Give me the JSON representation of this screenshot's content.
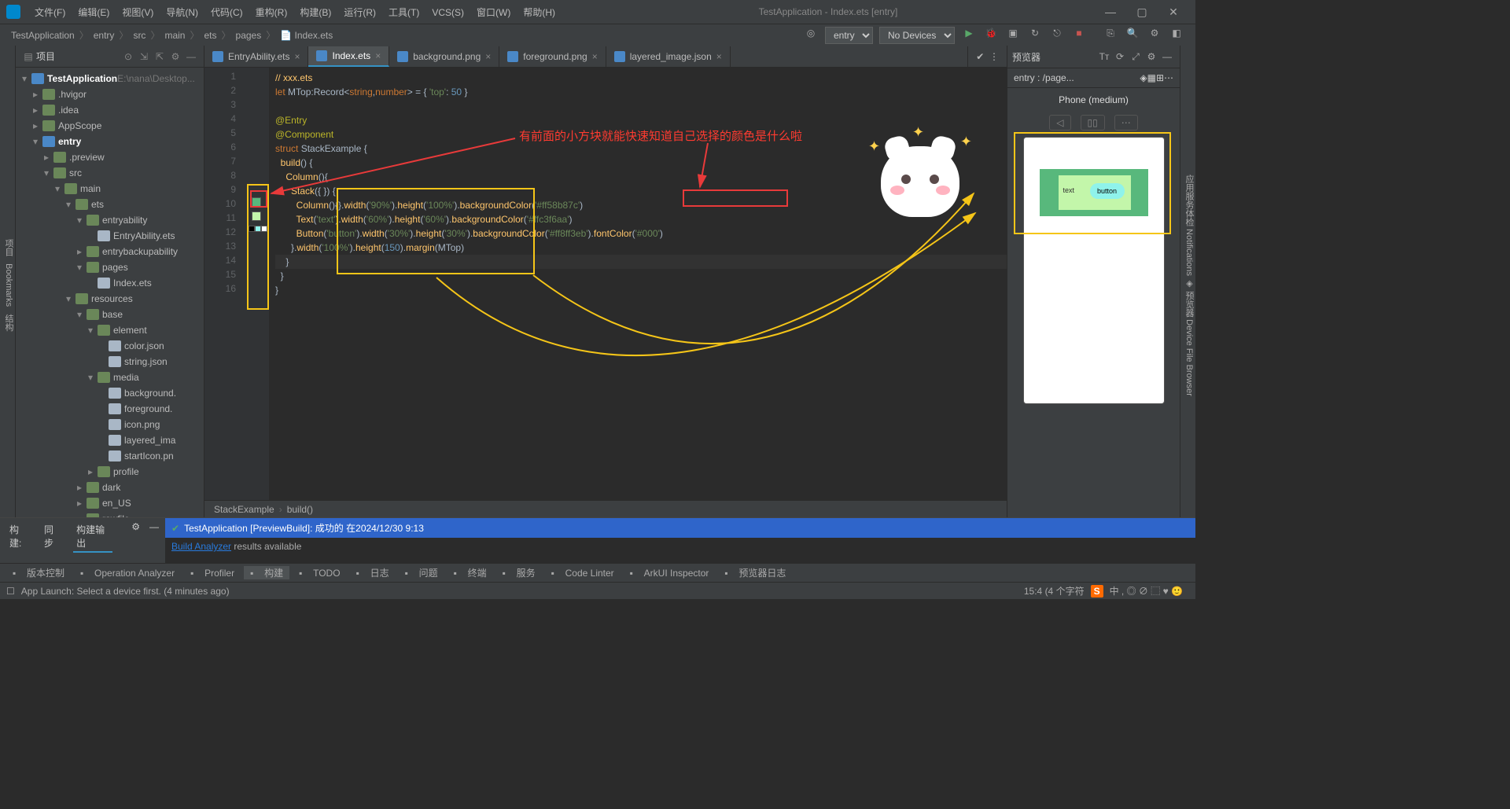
{
  "window_title": "TestApplication - Index.ets [entry]",
  "menu": [
    "文件(F)",
    "编辑(E)",
    "视图(V)",
    "导航(N)",
    "代码(C)",
    "重构(R)",
    "构建(B)",
    "运行(R)",
    "工具(T)",
    "VCS(S)",
    "窗口(W)",
    "帮助(H)"
  ],
  "breadcrumbs": [
    "TestApplication",
    "entry",
    "src",
    "main",
    "ets",
    "pages",
    "Index.ets"
  ],
  "toolbar": {
    "config": "entry",
    "device": "No Devices"
  },
  "project_panel_title": "项目",
  "tree": [
    {
      "d": 0,
      "a": "v",
      "t": "TestApplication",
      "suf": "E:\\nana\\Desktop...",
      "bold": true,
      "k": "module"
    },
    {
      "d": 1,
      "a": ">",
      "t": ".hvigor",
      "k": "folder"
    },
    {
      "d": 1,
      "a": ">",
      "t": ".idea",
      "k": "folder"
    },
    {
      "d": 1,
      "a": ">",
      "t": "AppScope",
      "k": "folder"
    },
    {
      "d": 1,
      "a": "v",
      "t": "entry",
      "bold": true,
      "k": "module"
    },
    {
      "d": 2,
      "a": ">",
      "t": ".preview",
      "k": "folder"
    },
    {
      "d": 2,
      "a": "v",
      "t": "src",
      "k": "folder"
    },
    {
      "d": 3,
      "a": "v",
      "t": "main",
      "k": "folder"
    },
    {
      "d": 4,
      "a": "v",
      "t": "ets",
      "k": "folder"
    },
    {
      "d": 5,
      "a": "v",
      "t": "entryability",
      "k": "folder"
    },
    {
      "d": 6,
      "a": "",
      "t": "EntryAbility.ets",
      "k": "file"
    },
    {
      "d": 5,
      "a": ">",
      "t": "entrybackupability",
      "k": "folder"
    },
    {
      "d": 5,
      "a": "v",
      "t": "pages",
      "k": "folder"
    },
    {
      "d": 6,
      "a": "",
      "t": "Index.ets",
      "k": "file"
    },
    {
      "d": 4,
      "a": "v",
      "t": "resources",
      "k": "folder"
    },
    {
      "d": 5,
      "a": "v",
      "t": "base",
      "k": "folder"
    },
    {
      "d": 6,
      "a": "v",
      "t": "element",
      "k": "folder"
    },
    {
      "d": 7,
      "a": "",
      "t": "color.json",
      "k": "file"
    },
    {
      "d": 7,
      "a": "",
      "t": "string.json",
      "k": "file"
    },
    {
      "d": 6,
      "a": "v",
      "t": "media",
      "k": "folder"
    },
    {
      "d": 7,
      "a": "",
      "t": "background.",
      "k": "file"
    },
    {
      "d": 7,
      "a": "",
      "t": "foreground.",
      "k": "file"
    },
    {
      "d": 7,
      "a": "",
      "t": "icon.png",
      "k": "file"
    },
    {
      "d": 7,
      "a": "",
      "t": "layered_ima",
      "k": "file"
    },
    {
      "d": 7,
      "a": "",
      "t": "startIcon.pn",
      "k": "file"
    },
    {
      "d": 6,
      "a": ">",
      "t": "profile",
      "k": "folder"
    },
    {
      "d": 5,
      "a": ">",
      "t": "dark",
      "k": "folder"
    },
    {
      "d": 5,
      "a": ">",
      "t": "en_US",
      "k": "folder"
    },
    {
      "d": 5,
      "a": ">",
      "t": "rawfile",
      "k": "folder"
    },
    {
      "d": 5,
      "a": ">",
      "t": "zh_CN",
      "k": "folder"
    }
  ],
  "tabs": [
    {
      "label": "EntryAbility.ets",
      "active": false
    },
    {
      "label": "Index.ets",
      "active": true
    },
    {
      "label": "background.png",
      "active": false
    },
    {
      "label": "foreground.png",
      "active": false
    },
    {
      "label": "layered_image.json",
      "active": false
    }
  ],
  "preview_tab": "预览器",
  "code_comment": "// xxx.ets",
  "code_values": {
    "mtop_key": "'top'",
    "mtop_val": "50",
    "struct_name": "StackExample",
    "col_w": "'90%'",
    "col_h": "'100%'",
    "col_bg": "'#ff58b87c'",
    "txt_t": "'text'",
    "txt_w": "'60%'",
    "txt_h": "'60%'",
    "txt_bg": "'#ffc3f6aa'",
    "btn_t": "'button'",
    "btn_w": "'30%'",
    "btn_h": "'30%'",
    "btn_bg": "'#ff8ff3eb'",
    "btn_fc": "'#000'",
    "stk_w": "'100%'",
    "stk_h": "150",
    "stk_m": "MTop"
  },
  "swatches": [
    {
      "line": 10,
      "colors": [
        "#58b87c"
      ]
    },
    {
      "line": 11,
      "colors": [
        "#c3f6aa"
      ]
    },
    {
      "line": 12,
      "colors": [
        "#000",
        "#8ff3eb",
        "#fff"
      ]
    }
  ],
  "annotation_text": "有前面的小方块就能快速知道自己选择的颜色是什么啦",
  "editor_breadcrumb": [
    "StackExample",
    "build()"
  ],
  "preview": {
    "entry_label": "entry : /page...",
    "device_label": "Phone (medium)",
    "text_label": "text",
    "button_label": "button"
  },
  "build": {
    "tabs": [
      "构建:",
      "同步",
      "构建输出"
    ],
    "success_line": "TestApplication [PreviewBuild]: 成功的 在2024/12/30 9:13",
    "analyzer_link": "Build Analyzer",
    "analyzer_rest": " results available"
  },
  "bottom_tools": [
    "版本控制",
    "Operation Analyzer",
    "Profiler",
    "构建",
    "TODO",
    "日志",
    "问题",
    "终端",
    "服务",
    "Code Linter",
    "ArkUI Inspector",
    "预览器日志"
  ],
  "status": {
    "msg": "App Launch: Select a device first. (4 minutes ago)",
    "pos": "15:4 (4 个字符",
    "ime": "S",
    "tray": "中 , ◎ ∅ ⬚ ♥ 🙂"
  },
  "colors": {
    "accent": "#3592c4",
    "green": "#58b87c",
    "lightgreen": "#c3f6aa",
    "cyan": "#8ff3eb"
  }
}
